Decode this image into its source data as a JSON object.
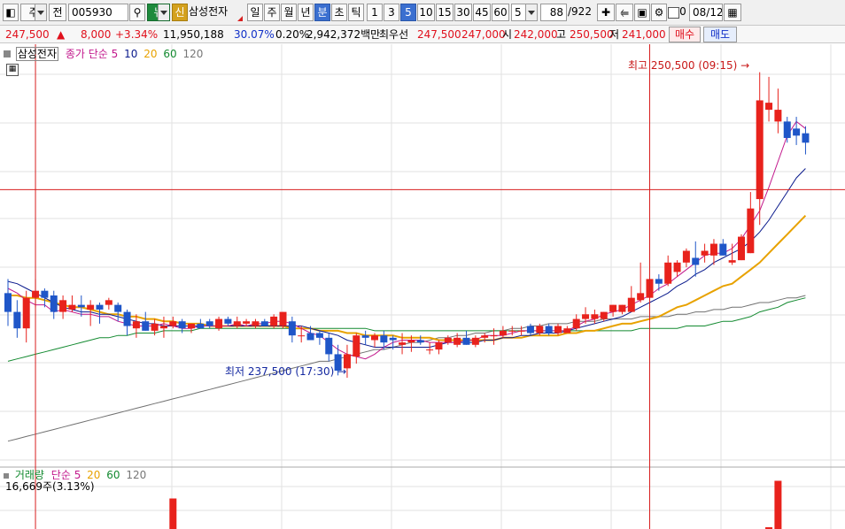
{
  "toolbar": {
    "market_type": "주",
    "jeon_label": "전",
    "stock_code": "005930",
    "new_label": "뉴",
    "sin_label": "신",
    "stock_name": "삼성전자",
    "period_buttons": [
      "일",
      "주",
      "월",
      "년",
      "분",
      "초",
      "틱"
    ],
    "interval_buttons": [
      "1",
      "3",
      "5",
      "10",
      "15",
      "30",
      "45",
      "60"
    ],
    "interval_value": "5",
    "count_current": "88",
    "count_total": "/922",
    "checkbox_value": "0",
    "date_value": "08/12"
  },
  "quote": {
    "price": "247,500",
    "change": "8,000",
    "change_rate": "+3.34%",
    "volume": "11,950,188",
    "volume_ratio": "30.07%",
    "turnover": "0.20%",
    "amount": "2,942,372백만",
    "best_label": "최우선",
    "best_ask": "247,500",
    "best_bid": "247,000",
    "open_label": "시",
    "open": "242,000",
    "high_label": "고",
    "high": "250,500",
    "low_label": "저",
    "low": "241,000",
    "buy_label": "매수",
    "sell_label": "매도"
  },
  "colors": {
    "up": "#e8221c",
    "down": "#1f56c8",
    "ma5": "#c2188c",
    "ma10": "#0a1a8c",
    "ma20": "#e8a200",
    "ma60": "#138a30",
    "ma120": "#707070",
    "crosshair": "#d81e1e"
  },
  "price_legend": {
    "stock": "삼성전자",
    "ma_label": "종가 단순",
    "p5": "5",
    "p10": "10",
    "p20": "20",
    "p60": "60",
    "p120": "120"
  },
  "volume_legend": {
    "title": "거래량",
    "ma_label": "단순",
    "p5": "5",
    "p20": "20",
    "p60": "60",
    "p120": "120",
    "value": "16,669주(3.13%)"
  },
  "annotations": {
    "high": "최고 250,500 (09:15)",
    "low": "최저 237,500 (17:30)"
  },
  "chart_data": {
    "type": "candlestick",
    "unit_note": "5-minute candles, 삼성전자",
    "candles": [
      {
        "o": 241100,
        "h": 241700,
        "l": 239700,
        "c": 240300
      },
      {
        "o": 240300,
        "h": 240800,
        "l": 239200,
        "c": 239600
      },
      {
        "o": 239600,
        "h": 241200,
        "l": 239000,
        "c": 240900
      },
      {
        "o": 240900,
        "h": 241700,
        "l": 240500,
        "c": 241200
      },
      {
        "o": 241200,
        "h": 241300,
        "l": 240500,
        "c": 240900
      },
      {
        "o": 241000,
        "h": 241200,
        "l": 240000,
        "c": 240300
      },
      {
        "o": 240300,
        "h": 241000,
        "l": 240000,
        "c": 240800
      },
      {
        "o": 240400,
        "h": 241000,
        "l": 240300,
        "c": 240600
      },
      {
        "o": 240600,
        "h": 241000,
        "l": 240100,
        "c": 240500
      },
      {
        "o": 240400,
        "h": 240800,
        "l": 239700,
        "c": 240600
      },
      {
        "o": 240600,
        "h": 240700,
        "l": 239800,
        "c": 240400
      },
      {
        "o": 240600,
        "h": 240900,
        "l": 240400,
        "c": 240800
      },
      {
        "o": 240600,
        "h": 240700,
        "l": 239900,
        "c": 240300
      },
      {
        "o": 240300,
        "h": 240400,
        "l": 239300,
        "c": 239700
      },
      {
        "o": 239600,
        "h": 240200,
        "l": 239200,
        "c": 239900
      },
      {
        "o": 239900,
        "h": 240300,
        "l": 239500,
        "c": 239500
      },
      {
        "o": 239500,
        "h": 240000,
        "l": 239300,
        "c": 239800
      },
      {
        "o": 239600,
        "h": 240100,
        "l": 239200,
        "c": 239700
      },
      {
        "o": 239700,
        "h": 240100,
        "l": 239600,
        "c": 239900
      },
      {
        "o": 239900,
        "h": 240000,
        "l": 239400,
        "c": 239600
      },
      {
        "o": 239600,
        "h": 239800,
        "l": 239400,
        "c": 239800
      },
      {
        "o": 239800,
        "h": 240000,
        "l": 239600,
        "c": 239600
      },
      {
        "o": 239900,
        "h": 240000,
        "l": 239600,
        "c": 239700
      },
      {
        "o": 239600,
        "h": 240100,
        "l": 239500,
        "c": 240000
      },
      {
        "o": 240000,
        "h": 240100,
        "l": 239700,
        "c": 239800
      },
      {
        "o": 239700,
        "h": 240100,
        "l": 239600,
        "c": 239900
      },
      {
        "o": 239800,
        "h": 240000,
        "l": 239700,
        "c": 239900
      },
      {
        "o": 239700,
        "h": 240000,
        "l": 239600,
        "c": 239900
      },
      {
        "o": 239900,
        "h": 240000,
        "l": 239700,
        "c": 239700
      },
      {
        "o": 239700,
        "h": 240200,
        "l": 239600,
        "c": 240100
      },
      {
        "o": 239700,
        "h": 240300,
        "l": 239600,
        "c": 240300
      },
      {
        "o": 239900,
        "h": 240100,
        "l": 239000,
        "c": 239300
      },
      {
        "o": 239300,
        "h": 239700,
        "l": 239000,
        "c": 239300
      },
      {
        "o": 239400,
        "h": 239700,
        "l": 239100,
        "c": 239100
      },
      {
        "o": 239400,
        "h": 239500,
        "l": 238900,
        "c": 239200
      },
      {
        "o": 239200,
        "h": 239400,
        "l": 238200,
        "c": 238500
      },
      {
        "o": 238500,
        "h": 238900,
        "l": 237600,
        "c": 237800
      },
      {
        "o": 237900,
        "h": 238900,
        "l": 237500,
        "c": 238500
      },
      {
        "o": 238400,
        "h": 239400,
        "l": 238100,
        "c": 239300
      },
      {
        "o": 239300,
        "h": 239500,
        "l": 238900,
        "c": 239200
      },
      {
        "o": 239100,
        "h": 239400,
        "l": 238800,
        "c": 239300
      },
      {
        "o": 239300,
        "h": 239500,
        "l": 238700,
        "c": 239000
      },
      {
        "o": 239200,
        "h": 239300,
        "l": 238700,
        "c": 239100
      },
      {
        "o": 238900,
        "h": 239400,
        "l": 238500,
        "c": 239000
      },
      {
        "o": 239000,
        "h": 239300,
        "l": 238600,
        "c": 239100
      },
      {
        "o": 239100,
        "h": 239300,
        "l": 238900,
        "c": 239000
      },
      {
        "o": 238700,
        "h": 239000,
        "l": 238500,
        "c": 238700
      },
      {
        "o": 238700,
        "h": 239100,
        "l": 238500,
        "c": 239000
      },
      {
        "o": 239000,
        "h": 239300,
        "l": 238900,
        "c": 239200
      },
      {
        "o": 238900,
        "h": 239400,
        "l": 238800,
        "c": 239200
      },
      {
        "o": 239200,
        "h": 239500,
        "l": 238900,
        "c": 238900
      },
      {
        "o": 238900,
        "h": 239300,
        "l": 238800,
        "c": 239200
      },
      {
        "o": 239200,
        "h": 239400,
        "l": 239000,
        "c": 239300
      },
      {
        "o": 239300,
        "h": 239600,
        "l": 238900,
        "c": 239300
      },
      {
        "o": 239300,
        "h": 239700,
        "l": 239200,
        "c": 239500
      },
      {
        "o": 239500,
        "h": 239700,
        "l": 239300,
        "c": 239500
      },
      {
        "o": 239500,
        "h": 239700,
        "l": 239300,
        "c": 239500
      },
      {
        "o": 239700,
        "h": 239800,
        "l": 239300,
        "c": 239400
      },
      {
        "o": 239400,
        "h": 239800,
        "l": 239300,
        "c": 239700
      },
      {
        "o": 239700,
        "h": 239800,
        "l": 239300,
        "c": 239400
      },
      {
        "o": 239400,
        "h": 239800,
        "l": 239300,
        "c": 239700
      },
      {
        "o": 239400,
        "h": 239700,
        "l": 239400,
        "c": 239600
      },
      {
        "o": 239600,
        "h": 240200,
        "l": 239500,
        "c": 240000
      },
      {
        "o": 240000,
        "h": 240500,
        "l": 239800,
        "c": 240200
      },
      {
        "o": 240000,
        "h": 240400,
        "l": 239800,
        "c": 240200
      },
      {
        "o": 240000,
        "h": 240300,
        "l": 239900,
        "c": 240300
      },
      {
        "o": 240300,
        "h": 240600,
        "l": 240100,
        "c": 240600
      },
      {
        "o": 240300,
        "h": 240600,
        "l": 240200,
        "c": 240600
      },
      {
        "o": 240300,
        "h": 241400,
        "l": 240300,
        "c": 240900
      },
      {
        "o": 240800,
        "h": 242400,
        "l": 240700,
        "c": 241100
      },
      {
        "o": 240900,
        "h": 241800,
        "l": 240800,
        "c": 241700
      },
      {
        "o": 241700,
        "h": 241900,
        "l": 241200,
        "c": 241500
      },
      {
        "o": 241500,
        "h": 242700,
        "l": 241400,
        "c": 242400
      },
      {
        "o": 242000,
        "h": 242500,
        "l": 241800,
        "c": 242400
      },
      {
        "o": 242400,
        "h": 243000,
        "l": 242200,
        "c": 242900
      },
      {
        "o": 242600,
        "h": 243300,
        "l": 241800,
        "c": 242300
      },
      {
        "o": 242700,
        "h": 243200,
        "l": 242400,
        "c": 242900
      },
      {
        "o": 242700,
        "h": 243400,
        "l": 242300,
        "c": 243200
      },
      {
        "o": 243200,
        "h": 243400,
        "l": 242700,
        "c": 242700
      },
      {
        "o": 242400,
        "h": 243200,
        "l": 242300,
        "c": 242500
      },
      {
        "o": 242500,
        "h": 243600,
        "l": 242500,
        "c": 243500
      },
      {
        "o": 242800,
        "h": 245400,
        "l": 242800,
        "c": 244700
      },
      {
        "o": 245100,
        "h": 250500,
        "l": 244000,
        "c": 249300
      },
      {
        "o": 248900,
        "h": 250300,
        "l": 248400,
        "c": 249200
      },
      {
        "o": 248400,
        "h": 249800,
        "l": 247900,
        "c": 248900
      },
      {
        "o": 248400,
        "h": 248600,
        "l": 247500,
        "c": 247700
      },
      {
        "o": 248100,
        "h": 248600,
        "l": 247400,
        "c": 247800
      },
      {
        "o": 247900,
        "h": 248200,
        "l": 247000,
        "c": 247500
      }
    ],
    "ma_lines": {
      "ma5": [
        241300,
        241100,
        240800,
        240600,
        240600,
        240300,
        240400,
        240300,
        240200,
        240200,
        240100,
        240100,
        239900,
        239800,
        239700,
        239700,
        239700,
        239800,
        239700,
        239600,
        239600,
        239700,
        239700,
        239700,
        239700,
        239800,
        239700,
        239800,
        239800,
        239900,
        239900,
        239800,
        239600,
        239400,
        239300,
        239000,
        238700,
        238500,
        238400,
        238300,
        238500,
        238800,
        239000,
        239100,
        239100,
        239100,
        239000,
        239000,
        239000,
        239000,
        239100,
        239100,
        239300,
        239300,
        239300,
        239400,
        239500,
        239500,
        239500,
        239500,
        239500,
        239500,
        239700,
        239900,
        240000,
        240200,
        240300,
        240400,
        240600,
        240800,
        241000,
        241300,
        241500,
        241800,
        242100,
        242400,
        242700,
        242800,
        242800,
        243000,
        243400,
        244000,
        244600,
        245600,
        246700,
        247800,
        248400,
        248100
      ],
      "ma10": [
        241600,
        241500,
        241300,
        241100,
        240900,
        240700,
        240500,
        240400,
        240300,
        240300,
        240200,
        240200,
        240100,
        240000,
        239900,
        239800,
        239800,
        239700,
        239700,
        239700,
        239700,
        239700,
        239700,
        239700,
        239700,
        239700,
        239700,
        239700,
        239700,
        239700,
        239700,
        239700,
        239700,
        239600,
        239500,
        239400,
        239300,
        239100,
        239000,
        238900,
        238800,
        238800,
        238800,
        238800,
        238800,
        238800,
        238800,
        238900,
        239000,
        239000,
        239000,
        239000,
        239100,
        239100,
        239200,
        239200,
        239300,
        239300,
        239400,
        239400,
        239400,
        239500,
        239600,
        239700,
        239800,
        239900,
        240000,
        240100,
        240300,
        240500,
        240700,
        240900,
        241100,
        241400,
        241600,
        241900,
        242100,
        242400,
        242600,
        242800,
        243000,
        243300,
        243700,
        244200,
        244800,
        245400,
        246000,
        246400
      ],
      "ma20": [
        241000,
        241000,
        240900,
        240900,
        240800,
        240700,
        240600,
        240500,
        240500,
        240400,
        240300,
        240200,
        240200,
        240100,
        240100,
        240000,
        240000,
        239900,
        239900,
        239800,
        239800,
        239800,
        239700,
        239700,
        239700,
        239700,
        239700,
        239700,
        239700,
        239700,
        239700,
        239600,
        239600,
        239600,
        239500,
        239500,
        239500,
        239400,
        239400,
        239300,
        239300,
        239300,
        239300,
        239200,
        239200,
        239200,
        239200,
        239100,
        239100,
        239100,
        239100,
        239100,
        239100,
        239100,
        239200,
        239200,
        239200,
        239300,
        239300,
        239300,
        239300,
        239400,
        239400,
        239500,
        239500,
        239600,
        239700,
        239800,
        239800,
        239900,
        240000,
        240100,
        240300,
        240500,
        240600,
        240800,
        241000,
        241200,
        241400,
        241500,
        241800,
        242100,
        242400,
        242800,
        243200,
        243600,
        244000,
        244400
      ],
      "ma60": [
        238200,
        238300,
        238400,
        238500,
        238600,
        238700,
        238800,
        238900,
        239000,
        239100,
        239200,
        239200,
        239300,
        239300,
        239400,
        239400,
        239400,
        239500,
        239500,
        239500,
        239500,
        239600,
        239600,
        239600,
        239600,
        239600,
        239600,
        239600,
        239600,
        239600,
        239600,
        239600,
        239600,
        239600,
        239600,
        239600,
        239600,
        239600,
        239600,
        239600,
        239500,
        239500,
        239500,
        239500,
        239500,
        239500,
        239500,
        239500,
        239500,
        239500,
        239500,
        239500,
        239500,
        239500,
        239500,
        239500,
        239500,
        239500,
        239500,
        239500,
        239500,
        239500,
        239500,
        239500,
        239500,
        239500,
        239500,
        239500,
        239500,
        239600,
        239600,
        239600,
        239600,
        239600,
        239700,
        239700,
        239700,
        239800,
        239900,
        239900,
        240000,
        240100,
        240300,
        240400,
        240500,
        240700,
        240800,
        240900
      ],
      "ma120": [
        234800,
        234900,
        235000,
        235100,
        235200,
        235300,
        235400,
        235500,
        235600,
        235700,
        235800,
        235900,
        236000,
        236100,
        236200,
        236300,
        236400,
        236500,
        236600,
        236700,
        236800,
        236900,
        237000,
        237100,
        237200,
        237300,
        237400,
        237500,
        237600,
        237700,
        237800,
        237900,
        238000,
        238100,
        238200,
        238200,
        238300,
        238400,
        238500,
        238600,
        238700,
        238700,
        238800,
        238900,
        239000,
        239000,
        239100,
        239200,
        239200,
        239300,
        239300,
        239400,
        239400,
        239500,
        239500,
        239600,
        239600,
        239700,
        239700,
        239800,
        239800,
        239800,
        239900,
        239900,
        239900,
        240000,
        240000,
        240000,
        240000,
        240100,
        240100,
        240100,
        240100,
        240200,
        240200,
        240300,
        240300,
        240400,
        240400,
        240500,
        240500,
        240600,
        240700,
        240700,
        240800,
        240900,
        240900,
        241000
      ]
    },
    "volume": [
      {
        "i": 18,
        "v": 69000,
        "up": true
      },
      {
        "i": 83,
        "v": 4000,
        "up": true
      },
      {
        "i": 84,
        "v": 109000,
        "up": true
      }
    ],
    "y_range": [
      234000,
      251500
    ],
    "volume_range": [
      0,
      120000
    ],
    "high_index": 82,
    "low_index": 36,
    "crosshair": {
      "candle_index_a": 3,
      "candle_index_b": 70,
      "price": 245500
    }
  }
}
